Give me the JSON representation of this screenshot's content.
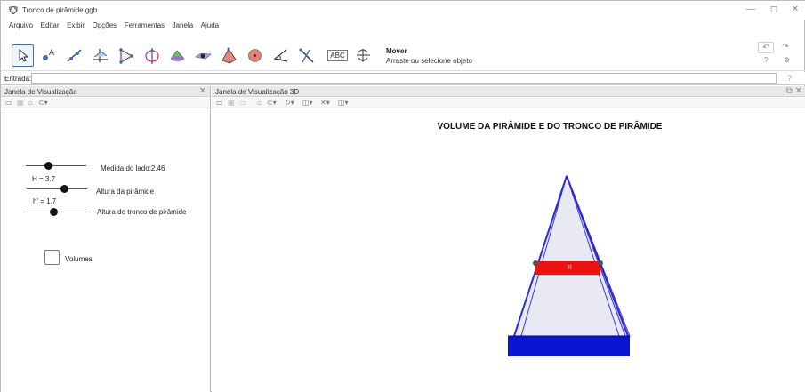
{
  "window": {
    "title": "Tronco de pirâmide.ggb",
    "minimize": "—",
    "maximize": "◻",
    "close": "✕"
  },
  "menu": [
    "Arquivo",
    "Editar",
    "Exibir",
    "Opções",
    "Ferramentas",
    "Janela",
    "Ajuda"
  ],
  "toolbar": {
    "tools": [
      {
        "name": "move-tool",
        "icon": "cursor-arrow",
        "active": true
      },
      {
        "name": "point-tool",
        "icon": "point-a"
      },
      {
        "name": "line-tool",
        "icon": "line"
      },
      {
        "name": "perpendicular-tool",
        "icon": "perpendicular"
      },
      {
        "name": "polygon-tool",
        "icon": "triangle"
      },
      {
        "name": "circle-tool",
        "icon": "circle-axis"
      },
      {
        "name": "intersect-surface-tool",
        "icon": "surface"
      },
      {
        "name": "plane-tool",
        "icon": "plane"
      },
      {
        "name": "pyramid-tool",
        "icon": "pyramid"
      },
      {
        "name": "sphere-tool",
        "icon": "sphere"
      },
      {
        "name": "angle-tool",
        "icon": "angle"
      },
      {
        "name": "reflect-tool",
        "icon": "reflect"
      },
      {
        "name": "text-tool",
        "icon": "abc",
        "label": "ABC"
      },
      {
        "name": "rotate-view-tool",
        "icon": "rotate"
      }
    ],
    "selected_title": "Mover",
    "selected_help": "Arraste ou selecione objeto",
    "undo": "↶",
    "redo": "↷",
    "help": "?",
    "settings": "⚙"
  },
  "input_bar": {
    "label": "Entrada:",
    "value": "",
    "help": "?"
  },
  "left_panel": {
    "title": "Janela de Visualização",
    "close": "✕",
    "sliders": [
      {
        "caption": "Medida do lado:2.46",
        "value_label": "",
        "fraction": 0.5
      },
      {
        "caption": "Altura da pirâmide",
        "value_label": "H = 3.7",
        "fraction": 0.74
      },
      {
        "caption": "Altura do tronco de pirâmide",
        "value_label": "h' = 1.7",
        "fraction": 0.34
      }
    ],
    "checkbox": {
      "label": "Volumes",
      "checked": false
    }
  },
  "right_panel": {
    "title": "Janela de Visualização 3D",
    "window_controls": "⧉ ✕",
    "graph_title": "VOLUME DA PIRÂMIDE E DO TRONCO DE PIRÂMIDE",
    "cut_label": "R",
    "colors": {
      "base": "#0a14d4",
      "cut": "#ee1111",
      "face": "#e8e8f4",
      "edge": "#2a2ad0"
    }
  }
}
